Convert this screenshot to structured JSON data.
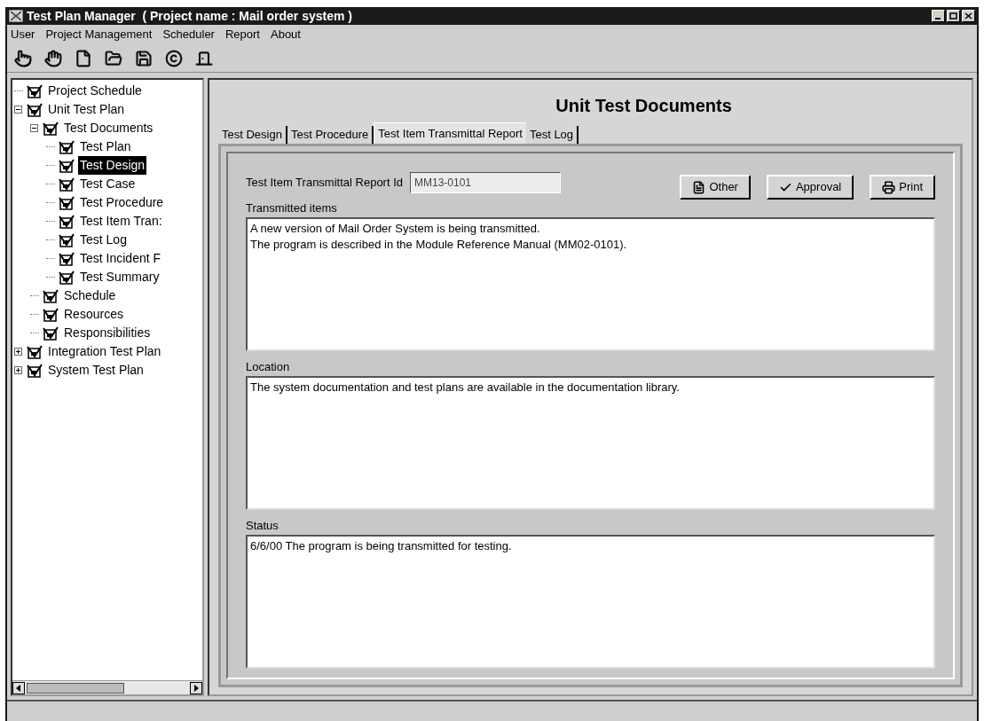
{
  "window": {
    "title": "Test Plan Manager  ( Project name : Mail order system )"
  },
  "menu": [
    {
      "label": "User"
    },
    {
      "label": "Project Management"
    },
    {
      "label": "Scheduler"
    },
    {
      "label": "Report"
    },
    {
      "label": "About"
    }
  ],
  "tree": [
    {
      "label": "Project Schedule",
      "kind": "leaf",
      "selected": false
    },
    {
      "label": "Unit Test Plan",
      "kind": "group",
      "expanded": true,
      "selected": false,
      "children": [
        {
          "label": "Test Documents",
          "kind": "group",
          "expanded": true,
          "selected": false,
          "children": [
            {
              "label": "Test Plan",
              "kind": "leaf",
              "selected": false
            },
            {
              "label": "Test Design",
              "kind": "leaf",
              "selected": true
            },
            {
              "label": "Test Case",
              "kind": "leaf",
              "selected": false
            },
            {
              "label": "Test Procedure",
              "kind": "leaf",
              "selected": false
            },
            {
              "label": "Test Item Tran:",
              "kind": "leaf",
              "selected": false
            },
            {
              "label": "Test Log",
              "kind": "leaf",
              "selected": false
            },
            {
              "label": "Test Incident F",
              "kind": "leaf",
              "selected": false
            },
            {
              "label": "Test Summary",
              "kind": "leaf",
              "selected": false
            }
          ]
        },
        {
          "label": "Schedule",
          "kind": "leaf",
          "selected": false
        },
        {
          "label": "Resources",
          "kind": "leaf",
          "selected": false
        },
        {
          "label": "Responsibilities",
          "kind": "leaf",
          "selected": false
        }
      ]
    },
    {
      "label": "Integration Test Plan",
      "kind": "group",
      "expanded": false,
      "selected": false
    },
    {
      "label": "System Test Plan",
      "kind": "group",
      "expanded": false,
      "selected": false
    }
  ],
  "heading": "Unit Test Documents",
  "tabs": [
    {
      "label": "Test Design",
      "selected": false
    },
    {
      "label": "Test Procedure",
      "selected": false
    },
    {
      "label": "Test Item Transmittal Report",
      "selected": true
    },
    {
      "label": "Test Log",
      "selected": false
    }
  ],
  "report_id": {
    "label": "Test Item Transmittal Report Id",
    "value": "MM13-0101"
  },
  "buttons": [
    {
      "label": "Other",
      "kind": "other"
    },
    {
      "label": "Approval",
      "kind": "approval"
    },
    {
      "label": "Print",
      "kind": "print"
    }
  ],
  "sections": [
    {
      "label": "Transmitted items",
      "value": "A new version of Mail Order System is being transmitted.\nThe program is described in the Module Reference Manual (MM02-0101)."
    },
    {
      "label": "Location",
      "value": "The system documentation and test plans are available in the documentation library."
    },
    {
      "label": "Status",
      "value": "6/6/00 The program is being transmitted for testing."
    }
  ]
}
